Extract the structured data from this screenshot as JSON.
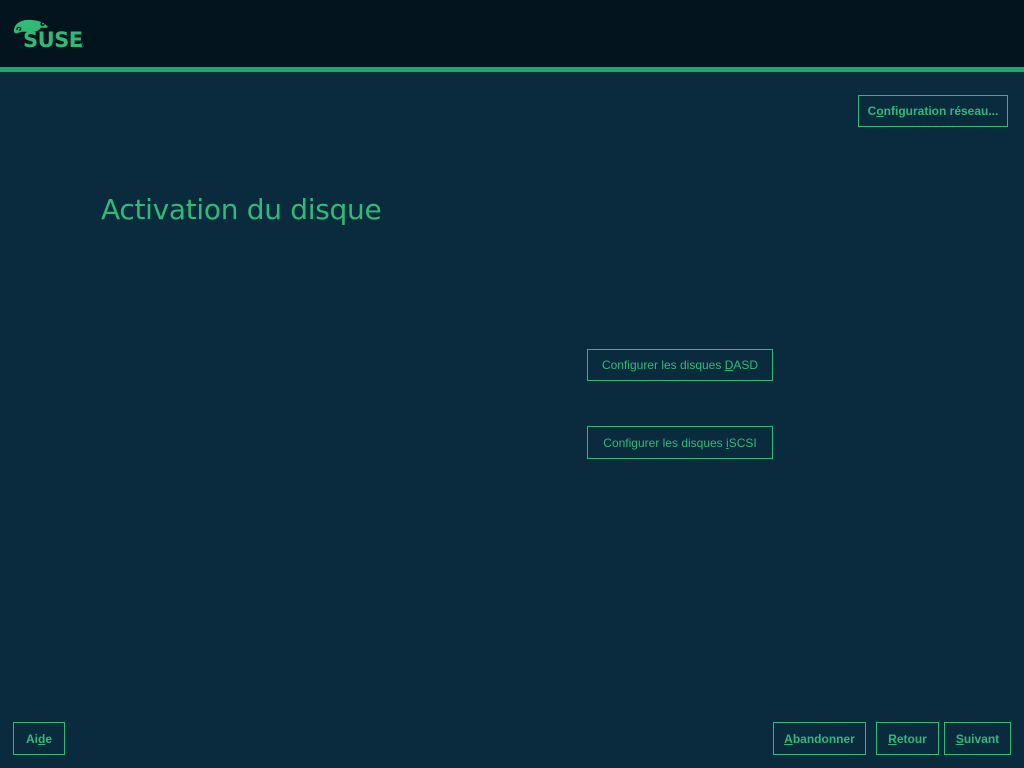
{
  "header": {
    "logo_text": "SUSE",
    "logo_mark": "®",
    "logo_icon": "chameleon-icon"
  },
  "colors": {
    "header_bg": "#04141f",
    "accent": "#30ba78",
    "accent_line": "#1aa86b",
    "page_bg": "#0a2a3e"
  },
  "toolbar": {
    "network": {
      "pre": "C",
      "mn": "o",
      "post": "nfiguration réseau..."
    }
  },
  "main": {
    "title": "Activation du disque",
    "dasd": {
      "pre": "Configurer les disques ",
      "mn": "D",
      "post": "ASD"
    },
    "iscsi": {
      "pre": "Configurer les disques ",
      "mn": "i",
      "post": "SCSI"
    }
  },
  "footer": {
    "help": {
      "pre": "Ai",
      "mn": "d",
      "post": "e"
    },
    "abort": {
      "pre": "",
      "mn": "A",
      "post": "bandonner"
    },
    "back": {
      "pre": "",
      "mn": "R",
      "post": "etour"
    },
    "next": {
      "pre": "",
      "mn": "S",
      "post": "uivant"
    }
  }
}
